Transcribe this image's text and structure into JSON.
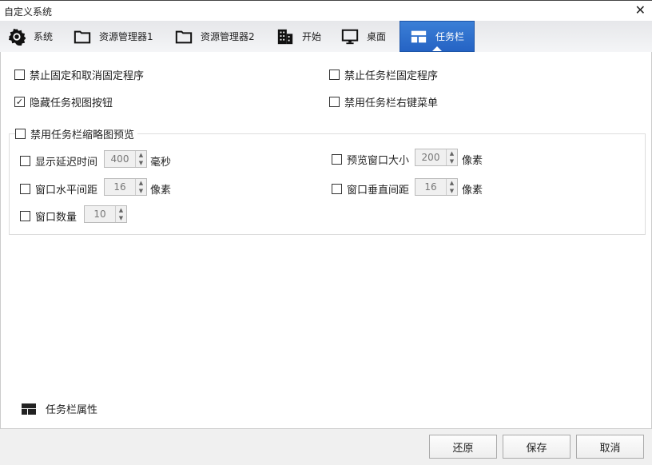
{
  "window": {
    "title": "自定义系统",
    "close": "✕"
  },
  "tabs": [
    {
      "label": "系统",
      "icon": "gear-icon"
    },
    {
      "label": "资源管理器1",
      "icon": "folder-icon"
    },
    {
      "label": "资源管理器2",
      "icon": "folder-icon"
    },
    {
      "label": "开始",
      "icon": "building-icon"
    },
    {
      "label": "桌面",
      "icon": "monitor-icon"
    },
    {
      "label": "任务栏",
      "icon": "taskbar-icon",
      "active": true
    }
  ],
  "options": [
    {
      "label": "禁止固定和取消固定程序",
      "checked": false
    },
    {
      "label": "禁止任务栏固定程序",
      "checked": false
    },
    {
      "label": "隐藏任务视图按钮",
      "checked": true
    },
    {
      "label": "禁用任务栏右键菜单",
      "checked": false
    }
  ],
  "group": {
    "label": "禁用任务栏缩略图预览",
    "checked": false,
    "items": [
      {
        "label": "显示延迟时间",
        "value": "400",
        "unit": "毫秒"
      },
      {
        "label": "预览窗口大小",
        "value": "200",
        "unit": "像素"
      },
      {
        "label": "窗口水平间距",
        "value": "16",
        "unit": "像素"
      },
      {
        "label": "窗口垂直间距",
        "value": "16",
        "unit": "像素"
      },
      {
        "label": "窗口数量",
        "value": "10"
      }
    ]
  },
  "link": {
    "label": "任务栏属性"
  },
  "buttons": {
    "restore": "还原",
    "save": "保存",
    "cancel": "取消"
  },
  "checkmark": "✓",
  "colors": {
    "accent": "#2a6fc9"
  }
}
